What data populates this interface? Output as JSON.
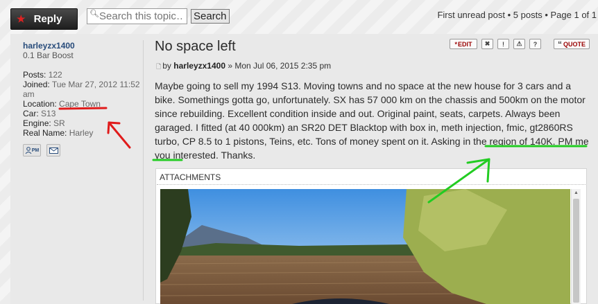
{
  "topbar": {
    "reply_label": "Reply",
    "search_placeholder": "Search this topic…",
    "search_button": "Search",
    "pagination": {
      "first_unread": "First unread post",
      "post_count": "5 posts",
      "page_info": "Page 1 of 1"
    }
  },
  "profile": {
    "username": "harleyzx1400",
    "rank": "0.1 Bar Boost",
    "posts_label": "Posts:",
    "posts_value": "122",
    "joined_label": "Joined:",
    "joined_value": "Tue Mar 27, 2012 11:52 am",
    "location_label": "Location:",
    "location_value": "Cape Town",
    "car_label": "Car:",
    "car_value": "S13",
    "engine_label": "Engine:",
    "engine_value": "SR",
    "realname_label": "Real Name:",
    "realname_value": "Harley",
    "pm_icon_text": "PM"
  },
  "post": {
    "title": "No space left",
    "by_prefix": "by",
    "author": "harleyzx1400",
    "date": "» Mon Jul 06, 2015 2:35 pm",
    "actions": {
      "edit": "EDIT",
      "quote": "QUOTE"
    },
    "body": "Maybe going to sell my 1994 S13. Moving towns and no space at the new house for 3 cars and a bike. Somethings gotta go, unfortunately. SX has 57 000 km on the chassis and 500km on the motor since rebuilding. Excellent condition inside and out. Original paint, seats, carpets. Always been garaged. I fitted (at 40 000km) an SR20 DET Blacktop with box in, meth injection, fmic, gt2860RS turbo, CP 8.5 to 1 pistons, Teins, etc. Tons of money spent on it. Asking in the region of 140K. PM me you interested. Thanks.",
    "attachments_label": "ATTACHMENTS"
  },
  "colors": {
    "annotation_red": "#e01b1b",
    "annotation_green": "#22cc22",
    "username_blue": "#274b7a"
  }
}
